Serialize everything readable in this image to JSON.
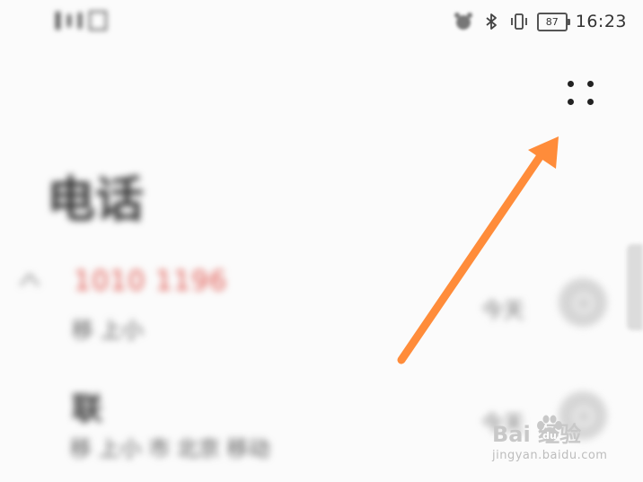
{
  "status_bar": {
    "left_text": "",
    "battery": "87",
    "time": "16:23"
  },
  "page": {
    "title": "电话",
    "entries": [
      {
        "number": "1010 1196",
        "subtitle": "移 上小",
        "tag": "今天"
      },
      {
        "name": "联",
        "subtitle": "移 上小 市 北京 移动",
        "tag": "今天"
      }
    ]
  },
  "annotation": {
    "color": "#ff8c3a"
  },
  "watermark": {
    "brand": "Bai  经验",
    "url": "jingyan.baidu.com"
  }
}
